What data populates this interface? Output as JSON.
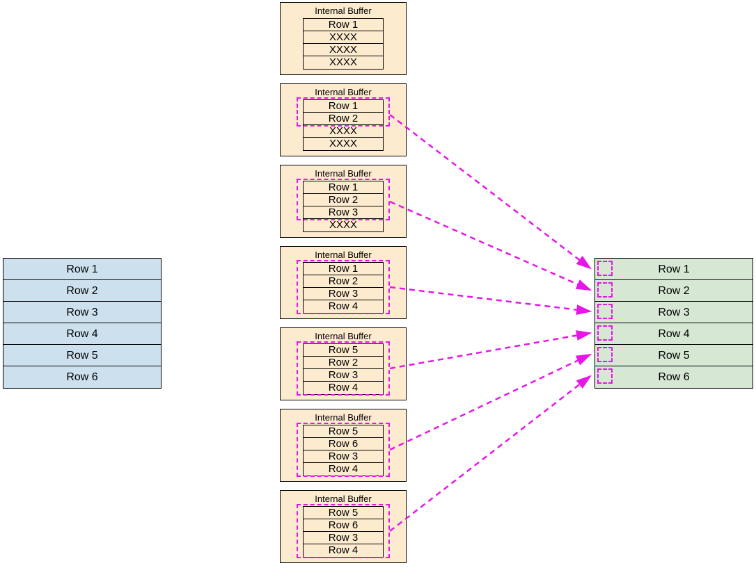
{
  "source": {
    "rows": [
      "Row 1",
      "Row 2",
      "Row 3",
      "Row 4",
      "Row 5",
      "Row 6"
    ]
  },
  "buffers": {
    "title": "Internal Buffer",
    "list": [
      {
        "rows": [
          "Row 1",
          "XXXX",
          "XXXX",
          "XXXX"
        ],
        "sel": false
      },
      {
        "rows": [
          "Row 1",
          "Row 2",
          "XXXX",
          "XXXX"
        ],
        "sel": true
      },
      {
        "rows": [
          "Row 1",
          "Row 2",
          "Row 3",
          "XXXX"
        ],
        "sel": true
      },
      {
        "rows": [
          "Row 1",
          "Row 2",
          "Row 3",
          "Row 4"
        ],
        "sel": true
      },
      {
        "rows": [
          "Row 5",
          "Row 2",
          "Row 3",
          "Row 4"
        ],
        "sel": true
      },
      {
        "rows": [
          "Row 5",
          "Row 6",
          "Row 3",
          "Row 4"
        ],
        "sel": true
      },
      {
        "rows": [
          "Row 5",
          "Row 6",
          "Row 3",
          "Row 4"
        ],
        "sel": true
      }
    ]
  },
  "dest": {
    "rows": [
      "Row 1",
      "Row 2",
      "Row 3",
      "Row 4",
      "Row 5",
      "Row 6"
    ]
  },
  "colors": {
    "source_bg": "#cde0ee",
    "buffer_bg": "#fcebcf",
    "dest_bg": "#d6e7d4",
    "selection": "#e815e8"
  }
}
